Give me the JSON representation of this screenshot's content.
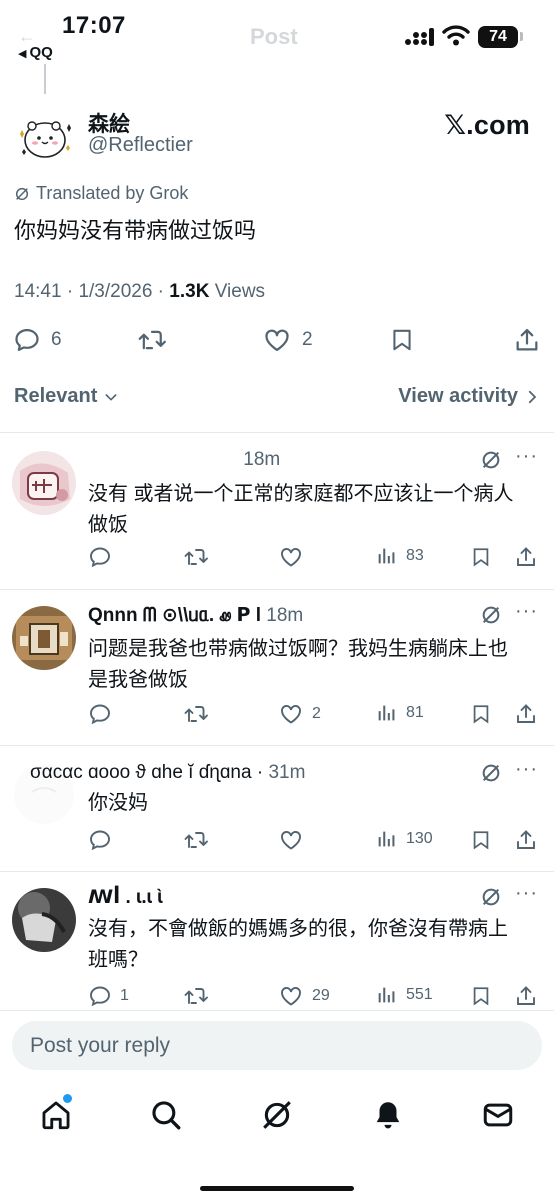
{
  "status": {
    "time": "17:07",
    "back_app": "QQ",
    "battery": "74",
    "ghost_title": "Post"
  },
  "post": {
    "author_name": "森絵",
    "author_handle": "@Reflectier",
    "site": "𝕏.com",
    "translated_label": "Translated by Grok",
    "text": "你妈妈没有带病做过饭吗",
    "time": "14:41",
    "date": "1/3/2026",
    "views_count": "1.3K",
    "views_label": "Views",
    "reply_count": "6",
    "like_count": "2"
  },
  "sort": {
    "left_label": "Relevant",
    "right_label": "View activity"
  },
  "replies": [
    {
      "name": "",
      "time": "18m",
      "text_line1": "没有 或者说一个正常的家庭都不应该让一个病人",
      "text_line2": "做饭",
      "replies": "",
      "likes": "",
      "views": "83"
    },
    {
      "name": "Qnnn ᗰ ⊙\\\\ᥙᥲ.  ꮺ  ꓑ l",
      "time": "18m",
      "text_line1": "问题是我爸也带病做过饭啊？我妈生病躺床上也",
      "text_line2": "是我爸做饭",
      "replies": "",
      "likes": "2",
      "views": "81"
    },
    {
      "name": "σαcαϲ ɑooo ϑ ɑhe ĭ ɗɳɑna",
      "time": "31m",
      "text_line1": "你没妈",
      "text_line2": "",
      "replies": "",
      "likes": "",
      "views": "130"
    },
    {
      "name": "ꟿꟾ  .              ɩ.ɩ  ɩ̀",
      "time": "",
      "text_line1": "沒有，不會做飯的媽媽多的很，你爸沒有帶病上",
      "text_line2": "班嗎？",
      "replies": "1",
      "likes": "29",
      "views": "551"
    }
  ],
  "composer": {
    "placeholder": "Post your reply"
  },
  "icons": {
    "reply": "reply-icon",
    "repost": "repost-icon",
    "like": "heart-icon",
    "bookmark": "bookmark-icon",
    "share": "share-icon",
    "views": "views-icon",
    "grok": "grok-icon",
    "more": "more-icon"
  },
  "colors": {
    "accent": "#1d9bf0",
    "text": "#0f1419",
    "muted": "#536471",
    "composer_bg": "#eff3f4"
  }
}
